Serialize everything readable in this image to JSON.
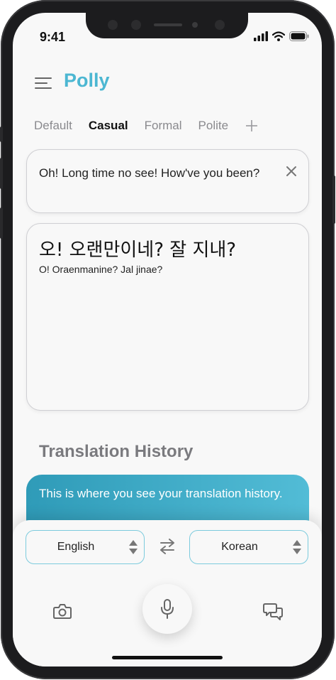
{
  "status": {
    "time": "9:41"
  },
  "app": {
    "title": "Polly"
  },
  "tabs": [
    {
      "label": "Default"
    },
    {
      "label": "Casual",
      "active": true
    },
    {
      "label": "Formal"
    },
    {
      "label": "Polite"
    }
  ],
  "input": {
    "text": "Oh! Long time no see! How've you been?"
  },
  "output": {
    "translation": "오! 오랜만이네? 잘 지내?",
    "romanization": "O! Oraenmanine? Jal jinae?"
  },
  "history": {
    "title": "Translation History",
    "placeholder": "This is where you see your translation history."
  },
  "languages": {
    "source": "English",
    "target": "Korean"
  },
  "colors": {
    "accent": "#4cb7d2",
    "history_gradient_start": "#2f9bb8",
    "history_gradient_end": "#52bcd6"
  },
  "icons": [
    "menu-icon",
    "close-icon",
    "swap-icon",
    "camera-icon",
    "microphone-icon",
    "chat-icon",
    "signal-icon",
    "wifi-icon",
    "battery-icon"
  ]
}
